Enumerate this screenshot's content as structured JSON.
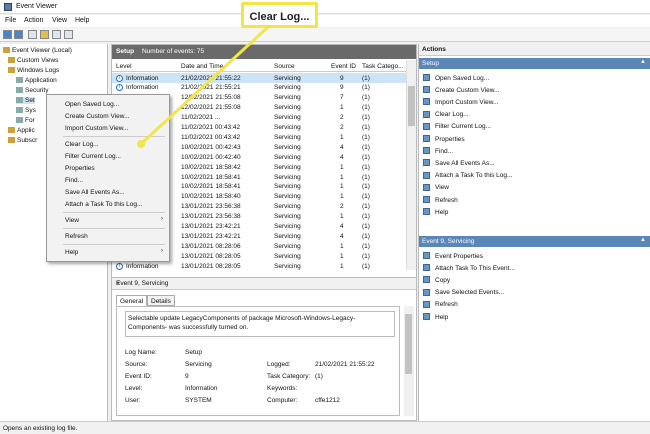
{
  "window": {
    "title": "Event Viewer"
  },
  "menubar": [
    "File",
    "Action",
    "View",
    "Help"
  ],
  "tree": [
    {
      "label": "Event Viewer (Local)"
    },
    {
      "label": "Custom Views"
    },
    {
      "label": "Windows Logs"
    },
    {
      "label": "Application"
    },
    {
      "label": "Security"
    },
    {
      "label": "Set"
    },
    {
      "label": "Sys"
    },
    {
      "label": "For"
    },
    {
      "label": "Applic"
    },
    {
      "label": "Subscr"
    }
  ],
  "log_header": {
    "name": "Setup",
    "count_text": "Number of events: 75"
  },
  "columns": [
    "Level",
    "Date and Time",
    "Source",
    "Event ID",
    "Task Catego..."
  ],
  "events": [
    {
      "level": "Information",
      "date": "21/02/2021 21:55:22",
      "source": "Servicing",
      "id": "9",
      "task": "(1)"
    },
    {
      "level": "Information",
      "date": "21/02/2021 21:55:21",
      "source": "Servicing",
      "id": "9",
      "task": "(1)"
    },
    {
      "level": "Information",
      "date": "12/02/2021 21:55:08",
      "source": "Servicing",
      "id": "7",
      "task": "(1)"
    },
    {
      "level": "Information",
      "date": "12/02/2021 21:55:08",
      "source": "Servicing",
      "id": "1",
      "task": "(1)"
    },
    {
      "level": "Information",
      "date": "11/02/2021 ...",
      "source": "Servicing",
      "id": "2",
      "task": "(1)"
    },
    {
      "level": "Information",
      "date": "11/02/2021 00:43:42",
      "source": "Servicing",
      "id": "2",
      "task": "(1)"
    },
    {
      "level": "Information",
      "date": "11/02/2021 00:43:42",
      "source": "Servicing",
      "id": "1",
      "task": "(1)"
    },
    {
      "level": "Information",
      "date": "10/02/2021 00:42:43",
      "source": "Servicing",
      "id": "4",
      "task": "(1)"
    },
    {
      "level": "Information",
      "date": "10/02/2021 00:42:40",
      "source": "Servicing",
      "id": "4",
      "task": "(1)"
    },
    {
      "level": "Information",
      "date": "10/02/2021 18:58:42",
      "source": "Servicing",
      "id": "1",
      "task": "(1)"
    },
    {
      "level": "Information",
      "date": "10/02/2021 18:58:41",
      "source": "Servicing",
      "id": "1",
      "task": "(1)"
    },
    {
      "level": "Information",
      "date": "10/02/2021 18:58:41",
      "source": "Servicing",
      "id": "1",
      "task": "(1)"
    },
    {
      "level": "Information",
      "date": "10/02/2021 18:58:40",
      "source": "Servicing",
      "id": "1",
      "task": "(1)"
    },
    {
      "level": "Information",
      "date": "13/01/2021 23:56:38",
      "source": "Servicing",
      "id": "2",
      "task": "(1)"
    },
    {
      "level": "Information",
      "date": "13/01/2021 23:56:38",
      "source": "Servicing",
      "id": "1",
      "task": "(1)"
    },
    {
      "level": "Information",
      "date": "13/01/2021 23:42:21",
      "source": "Servicing",
      "id": "4",
      "task": "(1)"
    },
    {
      "level": "Information",
      "date": "13/01/2021 23:42:21",
      "source": "Servicing",
      "id": "4",
      "task": "(1)"
    },
    {
      "level": "Information",
      "date": "13/01/2021 08:28:06",
      "source": "Servicing",
      "id": "1",
      "task": "(1)"
    },
    {
      "level": "Information",
      "date": "13/01/2021 08:28:05",
      "source": "Servicing",
      "id": "1",
      "task": "(1)"
    },
    {
      "level": "Information",
      "date": "13/01/2021 08:28:05",
      "source": "Servicing",
      "id": "1",
      "task": "(1)"
    }
  ],
  "detail": {
    "title": "Event 9, Servicing",
    "tabs": [
      "General",
      "Details"
    ],
    "message": "Selectable update LegacyComponents of package Microsoft-Windows-Legacy-Components- was successfully turned on.",
    "fields": [
      {
        "k": "Log Name:",
        "v": "Setup"
      },
      {
        "k": "Source:",
        "v": "Servicing"
      },
      {
        "k": "Event ID:",
        "v": "9"
      },
      {
        "k": "Level:",
        "v": "Information"
      },
      {
        "k": "User:",
        "v": "SYSTEM"
      }
    ],
    "fields2": [
      {
        "k": "Logged:",
        "v": "21/02/2021 21:55:22"
      },
      {
        "k": "Task Category:",
        "v": "(1)"
      },
      {
        "k": "Keywords:",
        "v": ""
      },
      {
        "k": "Computer:",
        "v": "cffe1212"
      }
    ]
  },
  "actions": {
    "title": "Actions",
    "section1": "Setup",
    "items1": [
      "Open Saved Log...",
      "Create Custom View...",
      "Import Custom View...",
      "Clear Log...",
      "Filter Current Log...",
      "Properties",
      "Find...",
      "Save All Events As...",
      "Attach a Task To this Log...",
      "View",
      "Refresh",
      "Help"
    ],
    "section2": "Event 9, Servicing",
    "items2": [
      "Event Properties",
      "Attach Task To This Event...",
      "Copy",
      "Save Selected Events...",
      "Refresh",
      "Help"
    ]
  },
  "context_menu": [
    "Open Saved Log...",
    "Create Custom View...",
    "Import Custom View...",
    "Clear Log...",
    "Filter Current Log...",
    "Properties",
    "Find...",
    "Save All Events As...",
    "Attach a Task To this Log...",
    "View",
    "Refresh",
    "Help"
  ],
  "callout": "Clear Log...",
  "status": "Opens an existing log file.",
  "colors": {
    "callout_border": "#f3e547",
    "section_bar": "#5b86b8",
    "selected_row": "#cde4f7"
  }
}
